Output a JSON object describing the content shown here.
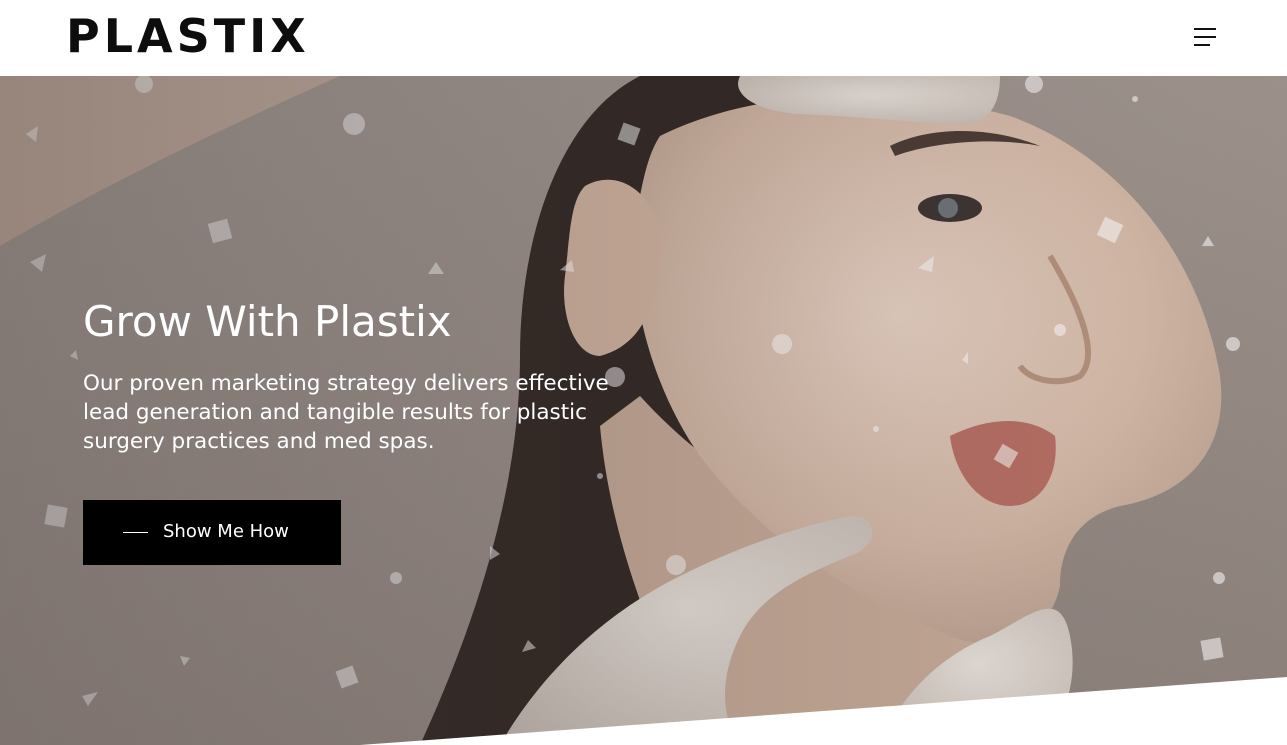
{
  "header": {
    "logo_text": "PLASTIX",
    "menu_icon": "hamburger-menu-icon"
  },
  "hero": {
    "title": "Grow With Plastix",
    "description": "Our proven marketing strategy delivers effective lead generation and tangible results for plastic surgery practices and med spas.",
    "cta_label": "Show Me How",
    "image_alt": "woman with gloved hands touching her face"
  },
  "colors": {
    "header_bg": "#ffffff",
    "logo": "#0d0d0d",
    "button_bg": "#000000",
    "button_text": "#ffffff",
    "hero_text": "#ffffff"
  }
}
